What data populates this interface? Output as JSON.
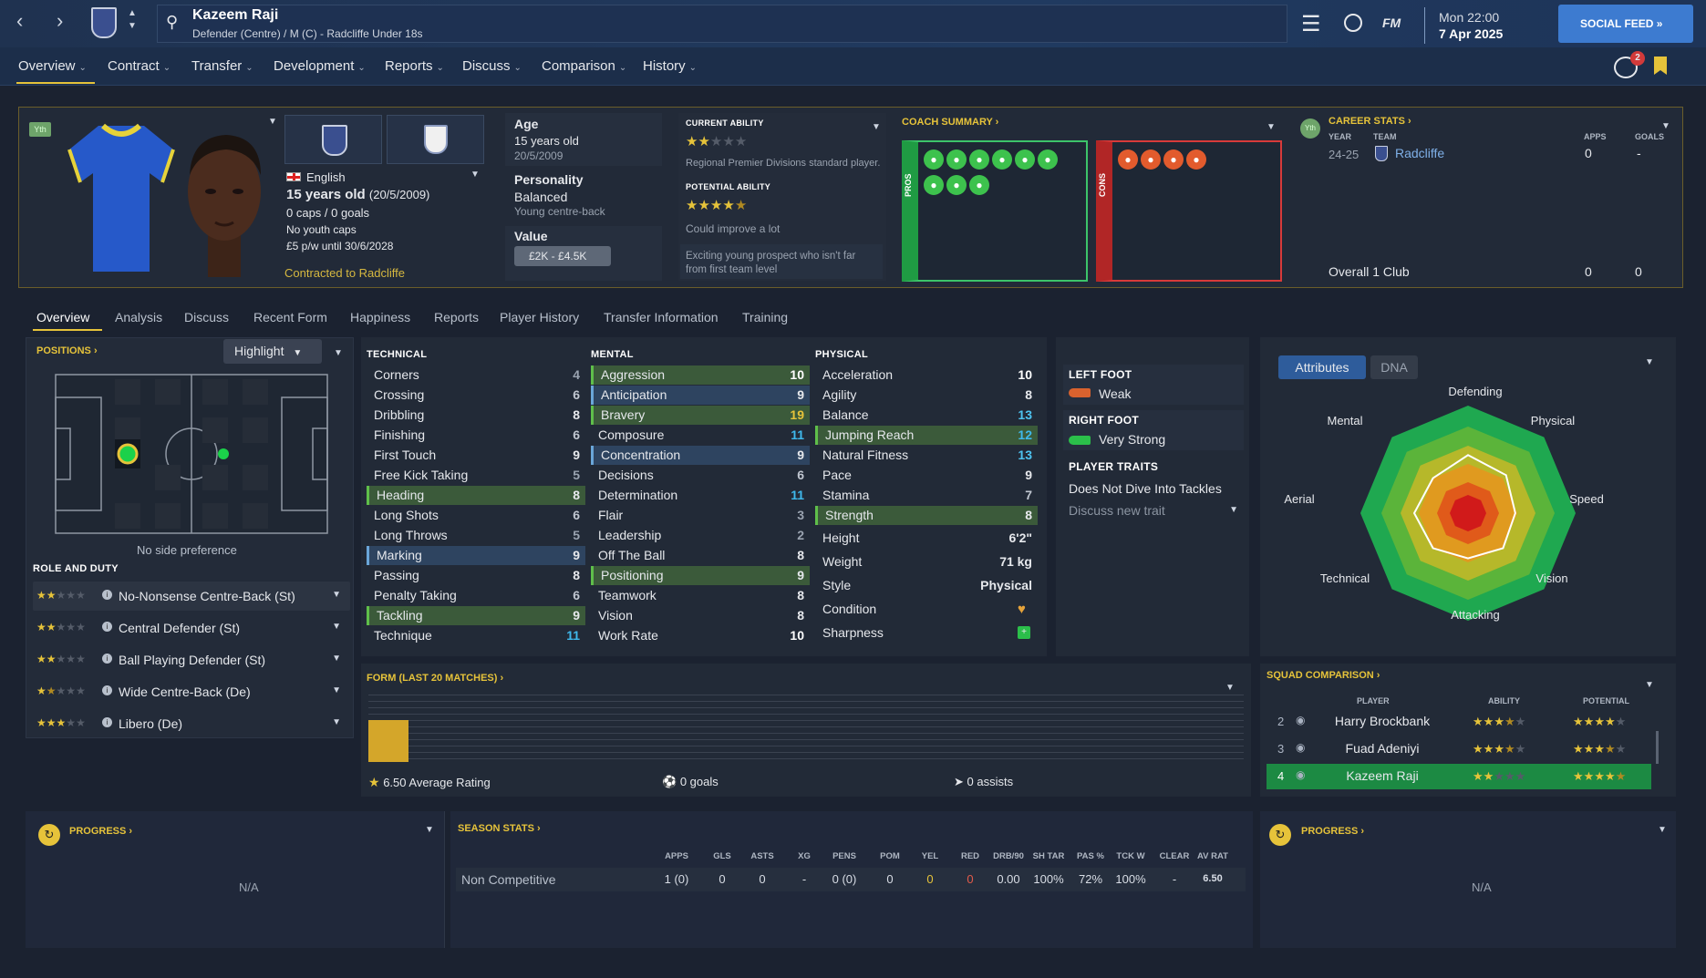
{
  "header": {
    "player_name": "Kazeem Raji",
    "player_sub": "Defender (Centre) / M (C) - Radcliffe Under 18s",
    "menu_icon": "hamburger-icon",
    "fm_label": "FM",
    "time": "Mon 22:00",
    "date": "7 Apr 2025",
    "social_feed": "SOCIAL FEED",
    "notification_count": "2"
  },
  "nav": {
    "items": [
      "Overview",
      "Contract",
      "Transfer",
      "Development",
      "Reports",
      "Discuss",
      "Comparison",
      "History"
    ]
  },
  "profile": {
    "yth_badge": "Yth",
    "nationality": "English",
    "age_line": "15 years old",
    "dob_paren": "(20/5/2009)",
    "caps": "0 caps / 0 goals",
    "youth_caps": "No youth caps",
    "contract": "£5 p/w until 30/6/2028",
    "contracted_to": "Contracted to Radcliffe",
    "age_label": "Age",
    "age_value": "15 years old",
    "age_dob": "20/5/2009",
    "personality_label": "Personality",
    "personality_value": "Balanced",
    "personality_sub": "Young centre-back",
    "value_label": "Value",
    "value_range": "£2K - £4.5K"
  },
  "ability": {
    "current_label": "CURRENT ABILITY",
    "current_stars": 2,
    "current_desc": "Regional Premier Divisions standard player.",
    "potential_label": "POTENTIAL ABILITY",
    "potential_stars": 4.5,
    "potential_desc": "Could improve a lot",
    "comment": "Exciting young prospect who isn't far from first team level"
  },
  "coach": {
    "title": "COACH SUMMARY",
    "pros_label": "PROS",
    "cons_label": "CONS"
  },
  "career": {
    "title": "CAREER STATS",
    "yth": "Yth",
    "col_year": "YEAR",
    "col_team": "TEAM",
    "col_apps": "APPS",
    "col_goals": "GOALS",
    "year": "24-25",
    "team": "Radcliffe",
    "apps": "0",
    "goals": "-",
    "overall_label": "Overall 1 Club",
    "overall_apps": "0",
    "overall_goals": "0"
  },
  "tabs": [
    "Overview",
    "Analysis",
    "Discuss",
    "Recent Form",
    "Happiness",
    "Reports",
    "Player History",
    "Transfer Information",
    "Training"
  ],
  "positions": {
    "title": "POSITIONS",
    "highlight": "Highlight",
    "side_pref": "No side preference",
    "role_title": "ROLE AND DUTY",
    "roles": [
      {
        "name": "No-Nonsense Centre-Back (St)",
        "stars": 2
      },
      {
        "name": "Central Defender (St)",
        "stars": 2
      },
      {
        "name": "Ball Playing Defender (St)",
        "stars": 2
      },
      {
        "name": "Wide Centre-Back (De)",
        "stars": 1.5
      },
      {
        "name": "Libero (De)",
        "stars": 3
      }
    ]
  },
  "attributes": {
    "technical_title": "TECHNICAL",
    "mental_title": "MENTAL",
    "physical_title": "PHYSICAL",
    "technical": [
      {
        "name": "Corners",
        "value": "4"
      },
      {
        "name": "Crossing",
        "value": "6"
      },
      {
        "name": "Dribbling",
        "value": "8"
      },
      {
        "name": "Finishing",
        "value": "6"
      },
      {
        "name": "First Touch",
        "value": "9"
      },
      {
        "name": "Free Kick Taking",
        "value": "5"
      },
      {
        "name": "Heading",
        "value": "8",
        "hl": "green"
      },
      {
        "name": "Long Shots",
        "value": "6"
      },
      {
        "name": "Long Throws",
        "value": "5"
      },
      {
        "name": "Marking",
        "value": "9",
        "hl": "blue"
      },
      {
        "name": "Passing",
        "value": "8"
      },
      {
        "name": "Penalty Taking",
        "value": "6"
      },
      {
        "name": "Tackling",
        "value": "9",
        "hl": "green"
      },
      {
        "name": "Technique",
        "value": "11"
      }
    ],
    "mental": [
      {
        "name": "Aggression",
        "value": "10",
        "hl": "green"
      },
      {
        "name": "Anticipation",
        "value": "9",
        "hl": "blue"
      },
      {
        "name": "Bravery",
        "value": "19",
        "hl": "green"
      },
      {
        "name": "Composure",
        "value": "11"
      },
      {
        "name": "Concentration",
        "value": "9",
        "hl": "blue"
      },
      {
        "name": "Decisions",
        "value": "6"
      },
      {
        "name": "Determination",
        "value": "11"
      },
      {
        "name": "Flair",
        "value": "3"
      },
      {
        "name": "Leadership",
        "value": "2"
      },
      {
        "name": "Off The Ball",
        "value": "8"
      },
      {
        "name": "Positioning",
        "value": "9",
        "hl": "green"
      },
      {
        "name": "Teamwork",
        "value": "8"
      },
      {
        "name": "Vision",
        "value": "8"
      },
      {
        "name": "Work Rate",
        "value": "10"
      }
    ],
    "physical": [
      {
        "name": "Acceleration",
        "value": "10"
      },
      {
        "name": "Agility",
        "value": "8"
      },
      {
        "name": "Balance",
        "value": "13"
      },
      {
        "name": "Jumping Reach",
        "value": "12",
        "hl": "green"
      },
      {
        "name": "Natural Fitness",
        "value": "13"
      },
      {
        "name": "Pace",
        "value": "9"
      },
      {
        "name": "Stamina",
        "value": "7"
      },
      {
        "name": "Strength",
        "value": "8",
        "hl": "green"
      }
    ],
    "height_label": "Height",
    "height": "6'2\"",
    "weight_label": "Weight",
    "weight": "71 kg",
    "style_label": "Style",
    "style": "Physical",
    "condition_label": "Condition",
    "sharpness_label": "Sharpness"
  },
  "feet": {
    "left_label": "LEFT FOOT",
    "left": "Weak",
    "right_label": "RIGHT FOOT",
    "right": "Very Strong",
    "traits_label": "PLAYER TRAITS",
    "trait": "Does Not Dive Into Tackles",
    "discuss_trait": "Discuss new trait"
  },
  "radar": {
    "tab_attributes": "Attributes",
    "tab_dna": "DNA",
    "labels": [
      "Defending",
      "Physical",
      "Speed",
      "Vision",
      "Attacking",
      "Technical",
      "Aerial",
      "Mental"
    ]
  },
  "form": {
    "title": "FORM (LAST 20 MATCHES)",
    "avg": "6.50 Average Rating",
    "goals": "0 goals",
    "assists": "0 assists"
  },
  "squad": {
    "title": "SQUAD COMPARISON",
    "col_player": "PLAYER",
    "col_ability": "ABILITY",
    "col_potential": "POTENTIAL",
    "rows": [
      {
        "rank": "2",
        "name": "Harry Brockbank",
        "ability": 3.5,
        "potential": 4
      },
      {
        "rank": "3",
        "name": "Fuad Adeniyi",
        "ability": 3.5,
        "potential": 3.5
      },
      {
        "rank": "4",
        "name": "Kazeem Raji",
        "ability": 2,
        "potential": 4.5
      }
    ]
  },
  "progress_left": {
    "title": "PROGRESS",
    "value": "N/A"
  },
  "progress_right": {
    "title": "PROGRESS",
    "value": "N/A"
  },
  "season": {
    "title": "SEASON STATS",
    "headers": [
      "APPS",
      "GLS",
      "ASTS",
      "XG",
      "PENS",
      "POM",
      "YEL",
      "RED",
      "DRB/90",
      "SH TAR",
      "PAS %",
      "TCK W",
      "CLEAR",
      "AV RAT"
    ],
    "row_label": "Non Competitive",
    "values": [
      "1 (0)",
      "0",
      "0",
      "-",
      "0 (0)",
      "0",
      "0",
      "0",
      "0.00",
      "100%",
      "72%",
      "100%",
      "-",
      "6.50"
    ]
  }
}
